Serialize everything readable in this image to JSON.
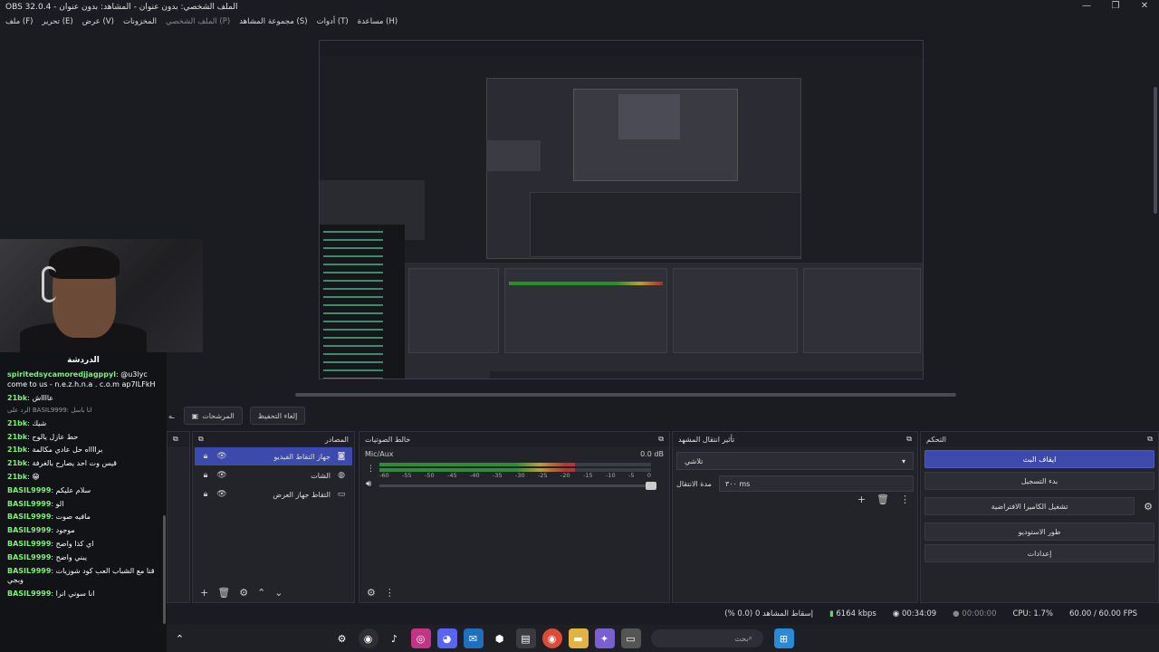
{
  "window": {
    "title": "OBS 32.0.4 - الملف الشخصي: بدون عنوان - المشاهد: بدون عنوان"
  },
  "menu": [
    "ملف (F)",
    "تحرير (E)",
    "عرض (V)",
    "المخزونات",
    "الملف الشخصي (P)",
    "مجموعة المشاهد (S)",
    "أدوات (T)",
    "مساعدة (H)"
  ],
  "chat": {
    "title": "الدردشة",
    "messages": [
      {
        "user": "spiritedsycamoredjjagppyl",
        "text": ": @u3lyc come to us - n.e.z.h.n.a . c.o.m ap7lLFkH"
      },
      {
        "user": "21bk",
        "text": ": عااااش"
      },
      {
        "reply": true,
        "text": "الرد على BASIL9999: انا باسل"
      },
      {
        "user": "21bk",
        "text": ": شيك"
      },
      {
        "user": "21bk",
        "text": ": حط عازل يالوح"
      },
      {
        "user": "21bk",
        "text": ": برااااه حل عادي مكالمة"
      },
      {
        "user": "21bk",
        "text": ": قيس وت احد يصارح بالغرفة"
      },
      {
        "user": "21bk",
        "text": ": 😁"
      },
      {
        "user": "BASIL9999",
        "text": ": سلام عليكم"
      },
      {
        "user": "BASIL9999",
        "text": ": الو"
      },
      {
        "user": "BASIL9999",
        "text": ": مافيه صوت"
      },
      {
        "user": "BASIL9999",
        "text": ": موجود"
      },
      {
        "user": "BASIL9999",
        "text": ": اي كذا واضح"
      },
      {
        "user": "BASIL9999",
        "text": ": يبني واضح"
      },
      {
        "user": "BASIL9999",
        "text": ": قنا مع الشباب العب كود شوزيات وبجي"
      },
      {
        "user": "BASIL9999",
        "text": ": انا سوني انرا"
      }
    ]
  },
  "tabs": {
    "scenes_transitions": "المرشحات",
    "cancel": "إلغاء التحفيظ"
  },
  "docks": {
    "sources": {
      "title": "المصادر",
      "items": [
        {
          "name": "جهاز التقاط الفيديو",
          "selected": true
        },
        {
          "name": "الشات",
          "selected": false
        },
        {
          "name": "التقاط جهاز العرض",
          "selected": false
        }
      ]
    },
    "mixer": {
      "title": "خالط الصوتيات",
      "channel": "Mic/Aux",
      "db": "0.0 dB",
      "scale": [
        "-60",
        "-55",
        "-50",
        "-45",
        "-40",
        "-35",
        "-30",
        "-25",
        "-20",
        "-15",
        "-10",
        "-5",
        "0"
      ],
      "level": 0.72
    },
    "transitions": {
      "title": "تأثير انتقال المشهد",
      "selected": "تلاشي",
      "duration_label": "مدة الانتقال",
      "duration_value": "٣٠٠ ms"
    },
    "controls": {
      "title": "التحكم",
      "buttons": [
        "ايقاف البث",
        "بدء التسجيل",
        "تشغيل الكاميرا الافتراضية",
        "طور الاستوديو",
        "إعدادات"
      ]
    }
  },
  "status": {
    "dropped": "إسقاط المشاهد 0 (0.0 %)",
    "bitrate": "6164 kbps",
    "live_time": "00:34:09",
    "rec_time": "00:00:00",
    "cpu": "CPU: 1.7%",
    "fps": "60.00 / 60.00 FPS"
  },
  "taskbar": {
    "search_placeholder": "بحث"
  }
}
